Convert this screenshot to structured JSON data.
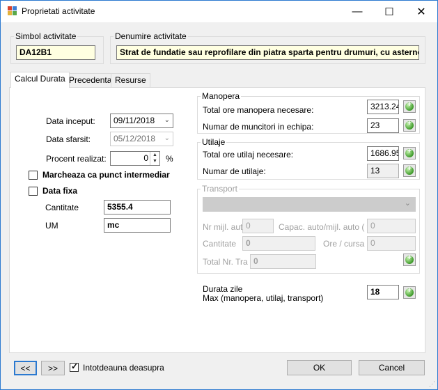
{
  "window": {
    "title": "Proprietati activitate"
  },
  "simbol": {
    "legend": "Simbol activitate",
    "value": "DA12B1"
  },
  "denumire": {
    "legend": "Denumire activitate",
    "value": "Strat de fundatie sau reprofilare din piatra sparta pentru drumuri, cu asternere"
  },
  "tabs": [
    {
      "label": "Calcul Durata"
    },
    {
      "label": "Precedenta"
    },
    {
      "label": "Resurse"
    }
  ],
  "left": {
    "data_inceput_label": "Data inceput:",
    "data_inceput": "09/11/2018",
    "data_sfarsit_label": "Data sfarsit:",
    "data_sfarsit": "05/12/2018",
    "procent_label": "Procent realizat:",
    "procent": "0",
    "procent_unit": "%",
    "punct_intermediar": "Marcheaza ca punct intermediar",
    "data_fixa": "Data fixa",
    "cantitate_label": "Cantitate",
    "cantitate": "5355.4",
    "um_label": "UM",
    "um": "mc"
  },
  "manopera": {
    "legend": "Manopera",
    "total_label": "Total ore manopera necesare:",
    "total": "3213.24",
    "numar_label": "Numar de muncitori in echipa:",
    "numar": "23"
  },
  "utilaje": {
    "legend": "Utilaje",
    "total_label": "Total ore utilaj necesare:",
    "total": "1686.95",
    "numar_label": "Numar de utilaje:",
    "numar": "13"
  },
  "transport": {
    "legend": "Transport",
    "nr_label": "Nr mijl. auto",
    "nr": "0",
    "capac_label": "Capac. auto/mijl. auto ( t )",
    "capac": "0",
    "cantitate_label": "Cantitate",
    "cantitate": "0",
    "ore_label": "Ore / cursa",
    "ore": "0",
    "total_label": "Total Nr. Tra",
    "total": "0"
  },
  "durata": {
    "label1": "Durata zile",
    "label2": "Max (manopera, utilaj, transport)",
    "value": "18"
  },
  "footer": {
    "prev": "<<",
    "next": ">>",
    "always_on_top": "Intotdeauna deasupra",
    "ok": "OK",
    "cancel": "Cancel"
  }
}
